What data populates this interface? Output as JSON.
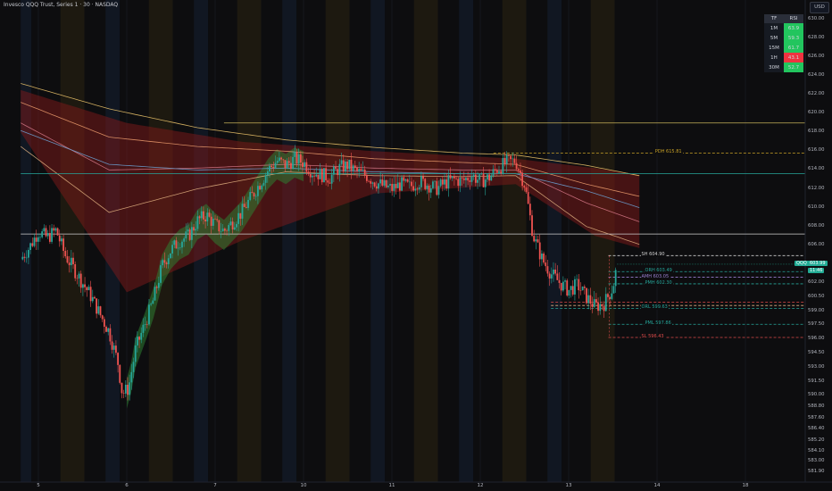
{
  "title": "Invesco QQQ Trust, Series 1 · 30 · NASDAQ",
  "currency_button": "USD",
  "rsi_table": {
    "headers": [
      "TF",
      "RSI"
    ],
    "rows": [
      {
        "tf": "1M",
        "rsi": "63.9",
        "color": "#22c55e"
      },
      {
        "tf": "5M",
        "rsi": "59.3",
        "color": "#22c55e"
      },
      {
        "tf": "15M",
        "rsi": "61.7",
        "color": "#22c55e"
      },
      {
        "tf": "1H",
        "rsi": "43.1",
        "color": "#ef3340"
      },
      {
        "tf": "30M",
        "rsi": "52.7",
        "color": "#22c55e"
      }
    ]
  },
  "last_price": {
    "symbol": "QQQ",
    "price": "603.99",
    "countdown": "11:46",
    "color": "#22ab94"
  },
  "chart_data": {
    "type": "candlestick",
    "title": "Invesco QQQ Trust, Series 1 · 30 · NASDAQ",
    "ylim": [
      581.4,
      631.5
    ],
    "y_ticks": [
      "630.00",
      "628.00",
      "626.00",
      "624.00",
      "622.00",
      "620.00",
      "618.00",
      "616.00",
      "614.00",
      "612.00",
      "610.00",
      "608.00",
      "606.00",
      "604.00",
      "602.00",
      "600.50",
      "599.00",
      "597.50",
      "596.00",
      "594.50",
      "593.00",
      "591.50",
      "590.00",
      "588.80",
      "587.60",
      "586.40",
      "585.20",
      "584.10",
      "583.00",
      "581.90"
    ],
    "x_ticks": [
      {
        "label": "5",
        "day": 0.2
      },
      {
        "label": "6",
        "day": 1.2
      },
      {
        "label": "7",
        "day": 2.2
      },
      {
        "label": "10",
        "day": 3.2
      },
      {
        "label": "11",
        "day": 4.2
      },
      {
        "label": "12",
        "day": 5.2
      },
      {
        "label": "13",
        "day": 6.2
      },
      {
        "label": "14",
        "day": 7.2
      },
      {
        "label": "18",
        "day": 8.2
      }
    ],
    "session_shading": [
      {
        "start": 0.0,
        "end": 0.12,
        "kind": "pre"
      },
      {
        "start": 0.45,
        "end": 0.72,
        "kind": "post"
      },
      {
        "start": 0.96,
        "end": 1.12,
        "kind": "pre"
      },
      {
        "start": 1.45,
        "end": 1.72,
        "kind": "post"
      },
      {
        "start": 1.96,
        "end": 2.12,
        "kind": "pre"
      },
      {
        "start": 2.45,
        "end": 2.72,
        "kind": "post"
      },
      {
        "start": 2.96,
        "end": 3.12,
        "kind": "pre"
      },
      {
        "start": 3.45,
        "end": 3.72,
        "kind": "post"
      },
      {
        "start": 3.96,
        "end": 4.12,
        "kind": "pre"
      },
      {
        "start": 4.45,
        "end": 4.72,
        "kind": "post"
      },
      {
        "start": 4.96,
        "end": 5.12,
        "kind": "pre"
      },
      {
        "start": 5.45,
        "end": 5.72,
        "kind": "post"
      },
      {
        "start": 5.96,
        "end": 6.12,
        "kind": "pre"
      },
      {
        "start": 6.45,
        "end": 6.72,
        "kind": "post"
      }
    ],
    "close_path": [
      [
        0.0,
        604.5
      ],
      [
        0.1,
        605.8
      ],
      [
        0.2,
        607.5
      ],
      [
        0.3,
        606.8
      ],
      [
        0.4,
        607.6
      ],
      [
        0.5,
        605.0
      ],
      [
        0.6,
        603.5
      ],
      [
        0.7,
        602.0
      ],
      [
        0.8,
        600.5
      ],
      [
        0.9,
        598.6
      ],
      [
        1.0,
        596.8
      ],
      [
        1.1,
        593.5
      ],
      [
        1.15,
        590.2
      ],
      [
        1.22,
        590.8
      ],
      [
        1.3,
        595.0
      ],
      [
        1.4,
        597.5
      ],
      [
        1.5,
        600.2
      ],
      [
        1.6,
        603.8
      ],
      [
        1.7,
        605.5
      ],
      [
        1.8,
        606.5
      ],
      [
        1.9,
        607.0
      ],
      [
        2.0,
        608.6
      ],
      [
        2.1,
        609.2
      ],
      [
        2.2,
        608.2
      ],
      [
        2.3,
        607.5
      ],
      [
        2.4,
        608.5
      ],
      [
        2.5,
        609.5
      ],
      [
        2.6,
        611.0
      ],
      [
        2.7,
        612.5
      ],
      [
        2.8,
        614.0
      ],
      [
        2.9,
        615.0
      ],
      [
        3.0,
        614.5
      ],
      [
        3.1,
        615.2
      ],
      [
        3.2,
        614.8
      ],
      [
        3.3,
        613.8
      ],
      [
        3.4,
        613.5
      ],
      [
        3.5,
        613.2
      ],
      [
        3.6,
        614.2
      ],
      [
        3.7,
        614.5
      ],
      [
        3.8,
        613.8
      ],
      [
        3.9,
        613.5
      ],
      [
        4.0,
        612.8
      ],
      [
        4.1,
        612.3
      ],
      [
        4.2,
        612.0
      ],
      [
        4.3,
        612.5
      ],
      [
        4.4,
        612.2
      ],
      [
        4.5,
        612.8
      ],
      [
        4.6,
        612.5
      ],
      [
        4.7,
        612.0
      ],
      [
        4.8,
        612.6
      ],
      [
        4.9,
        613.0
      ],
      [
        5.0,
        612.8
      ],
      [
        5.1,
        613.5
      ],
      [
        5.2,
        612.8
      ],
      [
        5.3,
        613.2
      ],
      [
        5.4,
        614.2
      ],
      [
        5.5,
        614.8
      ],
      [
        5.6,
        615.0
      ],
      [
        5.7,
        612.5
      ],
      [
        5.8,
        607.0
      ],
      [
        5.9,
        604.5
      ],
      [
        6.0,
        603.0
      ],
      [
        6.1,
        602.0
      ],
      [
        6.2,
        601.2
      ],
      [
        6.3,
        601.8
      ],
      [
        6.4,
        600.5
      ],
      [
        6.5,
        599.5
      ],
      [
        6.6,
        599.8
      ],
      [
        6.7,
        601.5
      ],
      [
        6.75,
        603.99
      ]
    ],
    "ribbon_bands": [
      {
        "name_hidden": true,
        "color": "#8b1a1a",
        "upper": [
          [
            0.0,
            622.5
          ],
          [
            1.2,
            619.0
          ],
          [
            2.5,
            617.0
          ],
          [
            4.0,
            616.0
          ],
          [
            5.6,
            615.2
          ],
          [
            6.5,
            614.2
          ],
          [
            7.0,
            613.5
          ]
        ],
        "lower": [
          [
            0.0,
            618.0
          ],
          [
            1.2,
            601.0
          ],
          [
            2.5,
            606.5
          ],
          [
            4.0,
            611.5
          ],
          [
            5.6,
            612.5
          ],
          [
            6.5,
            607.0
          ],
          [
            7.0,
            605.7
          ]
        ]
      }
    ],
    "ma_lines": [
      {
        "color": "#f2c96d",
        "points": [
          [
            0.0,
            623.2
          ],
          [
            1.0,
            620.5
          ],
          [
            2.0,
            618.5
          ],
          [
            3.0,
            617.2
          ],
          [
            4.0,
            616.4
          ],
          [
            5.0,
            615.8
          ],
          [
            5.6,
            615.6
          ],
          [
            6.4,
            614.5
          ],
          [
            7.0,
            613.4
          ]
        ]
      },
      {
        "color": "#f0a070",
        "points": [
          [
            0.0,
            621.2
          ],
          [
            1.0,
            617.5
          ],
          [
            2.0,
            616.5
          ],
          [
            3.0,
            616.0
          ],
          [
            4.0,
            615.2
          ],
          [
            5.0,
            614.8
          ],
          [
            5.6,
            614.6
          ],
          [
            6.4,
            612.5
          ],
          [
            7.0,
            611.2
          ]
        ]
      },
      {
        "color": "#d87a8a",
        "points": [
          [
            0.0,
            619.0
          ],
          [
            1.0,
            614.0
          ],
          [
            2.0,
            614.2
          ],
          [
            3.0,
            614.6
          ],
          [
            4.0,
            614.2
          ],
          [
            5.0,
            614.0
          ],
          [
            5.6,
            614.0
          ],
          [
            6.4,
            610.5
          ],
          [
            7.0,
            608.5
          ]
        ]
      },
      {
        "color": "#e0b080",
        "points": [
          [
            0.0,
            616.5
          ],
          [
            1.0,
            609.5
          ],
          [
            2.0,
            612.0
          ],
          [
            3.0,
            613.8
          ],
          [
            4.0,
            613.4
          ],
          [
            5.0,
            613.3
          ],
          [
            5.6,
            613.4
          ],
          [
            6.4,
            608.0
          ],
          [
            7.0,
            606.1
          ]
        ]
      },
      {
        "color": "#6fa8dc",
        "points": [
          [
            0.0,
            618.2
          ],
          [
            1.0,
            614.6
          ],
          [
            2.0,
            614.0
          ],
          [
            3.0,
            614.2
          ],
          [
            4.0,
            613.8
          ],
          [
            5.0,
            613.6
          ],
          [
            5.6,
            613.6
          ],
          [
            6.4,
            611.8
          ],
          [
            7.0,
            610.0
          ]
        ]
      }
    ],
    "levels": [
      {
        "label": "",
        "price": 619.0,
        "color": "#c9b25a",
        "style": "solid",
        "from_day": 2.3,
        "to_day": 9.0
      },
      {
        "label": "PDH 615.81",
        "price": 615.81,
        "color": "#c9a227",
        "style": "dashed",
        "from_day": 5.35,
        "to_day": 9.0
      },
      {
        "label": "",
        "price": 613.6,
        "color": "#26a69a",
        "style": "solid",
        "from_day": 0.0,
        "to_day": 9.0
      },
      {
        "label": "",
        "price": 607.2,
        "color": "#cfcfcf",
        "style": "solid",
        "from_day": 0.0,
        "to_day": 9.0
      },
      {
        "label": "SH 604.90",
        "price": 604.9,
        "color": "#cfcfcf",
        "style": "dashed",
        "from_day": 6.65,
        "to_day": 9.0
      },
      {
        "label": "ORH 603.49",
        "price": 603.2,
        "color": "#26a69a",
        "style": "dashed",
        "from_day": 6.65,
        "to_day": 9.0
      },
      {
        "label": "AMH 603.05",
        "price": 602.6,
        "color": "#9b7fd1",
        "style": "dashed",
        "from_day": 6.65,
        "to_day": 9.0
      },
      {
        "label": "PMH 602.30",
        "price": 601.9,
        "color": "#26a69a",
        "style": "dashed",
        "from_day": 6.65,
        "to_day": 9.0
      },
      {
        "label": "",
        "price": 599.95,
        "color": "#e04b4b",
        "style": "dashed",
        "from_day": 6.0,
        "to_day": 9.0
      },
      {
        "label": "",
        "price": 599.6,
        "color": "#e0b080",
        "style": "dashed",
        "from_day": 6.0,
        "to_day": 9.0
      },
      {
        "label": "ORL 599.63",
        "price": 599.3,
        "color": "#26a69a",
        "style": "dashed",
        "from_day": 6.0,
        "to_day": 9.0
      },
      {
        "label": "PML 597.86",
        "price": 597.6,
        "color": "#26a69a",
        "style": "dashed",
        "from_day": 6.65,
        "to_day": 9.0
      },
      {
        "label": "SL 596.43",
        "price": 596.2,
        "color": "#e04b4b",
        "style": "dashed",
        "from_day": 6.65,
        "to_day": 9.0
      }
    ]
  }
}
